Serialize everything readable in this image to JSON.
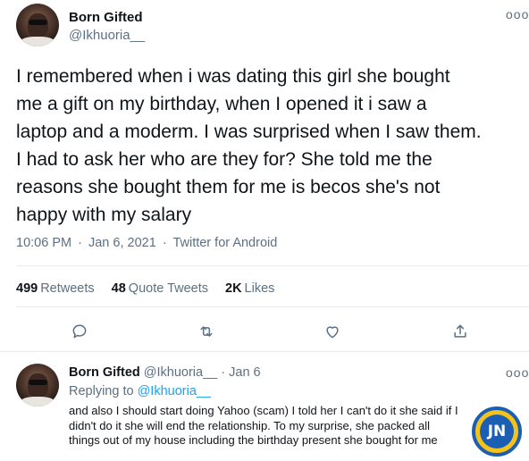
{
  "main_tweet": {
    "display_name": "Born Gifted",
    "handle": "@Ikhuoria__",
    "text": "I remembered when i was dating this girl she bought\nme a gift on my birthday, when I opened it i saw a\nlaptop and a moderm. I was surprised when I saw them.\nI had to ask her who are they for? She told me the\nreasons she bought them for me is becos she's not\nhappy with my salary",
    "time": "10:06 PM",
    "date": "Jan 6, 2021",
    "source": "Twitter for Android",
    "separator": "·",
    "more_glyph": "ooo",
    "stats": {
      "retweets_count": "499",
      "retweets_label": "Retweets",
      "quote_count": "48",
      "quote_label": "Quote Tweets",
      "likes_count": "2K",
      "likes_label": "Likes"
    },
    "actions": [
      "reply-icon",
      "retweet-icon",
      "like-icon",
      "share-icon"
    ]
  },
  "reply_tweet": {
    "display_name": "Born Gifted",
    "handle": "@Ikhuoria__",
    "separator": "·",
    "date": "Jan 6",
    "replying_prefix": "Replying to",
    "replying_to": "@Ikhuoria__",
    "more_glyph": "ooo",
    "text": "and also I should start doing Yahoo (scam) I told her I can't do it she said if I\ndidn't do it she will end the relationship. To my surprise, she packed all\nthings out of my house including the birthday present she bought for me"
  },
  "watermark": {
    "text": "JN"
  },
  "colors": {
    "text": "#0f1419",
    "secondary": "#5b7083",
    "link": "#1da1f2",
    "divider": "#e6ecf0"
  }
}
